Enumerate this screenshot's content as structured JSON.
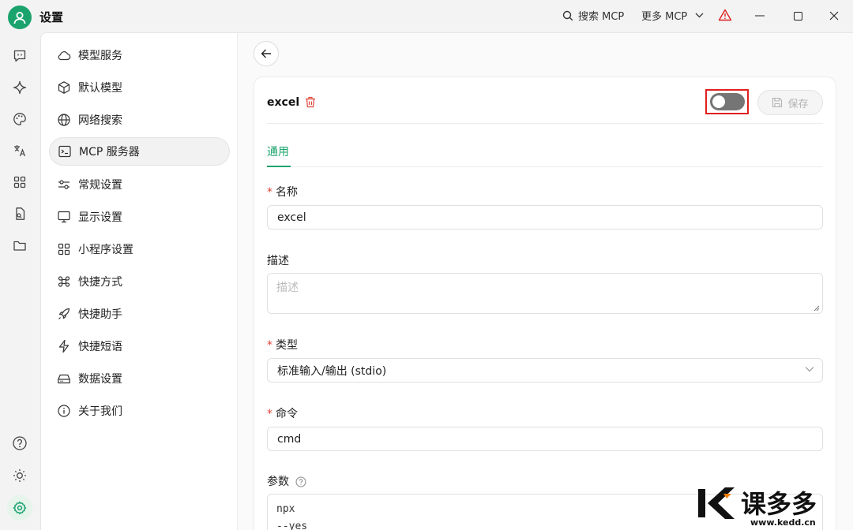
{
  "window": {
    "title": "设置"
  },
  "toolbar": {
    "search_label": "搜索 MCP",
    "more_label": "更多 MCP"
  },
  "colors": {
    "accent": "#1aa36d",
    "danger": "#e0443a",
    "warning": "#e02020"
  },
  "rail": {
    "items": [
      "chat-icon",
      "sparkle-icon",
      "palette-icon",
      "translate-icon",
      "apps-grid-icon",
      "files-icon",
      "folder-icon"
    ],
    "bottom": [
      "help-icon",
      "theme-icon",
      "settings-icon"
    ]
  },
  "nav": {
    "items": [
      {
        "label": "模型服务",
        "icon": "cloud-icon"
      },
      {
        "label": "默认模型",
        "icon": "cube-icon"
      },
      {
        "label": "网络搜索",
        "icon": "globe-icon"
      },
      {
        "label": "MCP 服务器",
        "icon": "terminal-icon",
        "active": true
      },
      {
        "label": "常规设置",
        "icon": "sliders-icon"
      },
      {
        "label": "显示设置",
        "icon": "monitor-icon"
      },
      {
        "label": "小程序设置",
        "icon": "grid-icon"
      },
      {
        "label": "快捷方式",
        "icon": "command-icon"
      },
      {
        "label": "快捷助手",
        "icon": "rocket-icon"
      },
      {
        "label": "快捷短语",
        "icon": "zap-icon"
      },
      {
        "label": "数据设置",
        "icon": "hard-drive-icon"
      },
      {
        "label": "关于我们",
        "icon": "info-icon"
      }
    ]
  },
  "server": {
    "name": "excel",
    "enabled": false,
    "save_label": "保存",
    "tab_general": "通用",
    "fields": {
      "name_label": "名称",
      "name_value": "excel",
      "desc_label": "描述",
      "desc_placeholder": "描述",
      "type_label": "类型",
      "type_value": "标准输入/输出 (stdio)",
      "command_label": "命令",
      "command_value": "cmd",
      "args_label": "参数",
      "args_lines": [
        "npx",
        "--yes"
      ]
    }
  },
  "watermark": {
    "brand": "课多多",
    "url": "www.kedd.cn"
  }
}
